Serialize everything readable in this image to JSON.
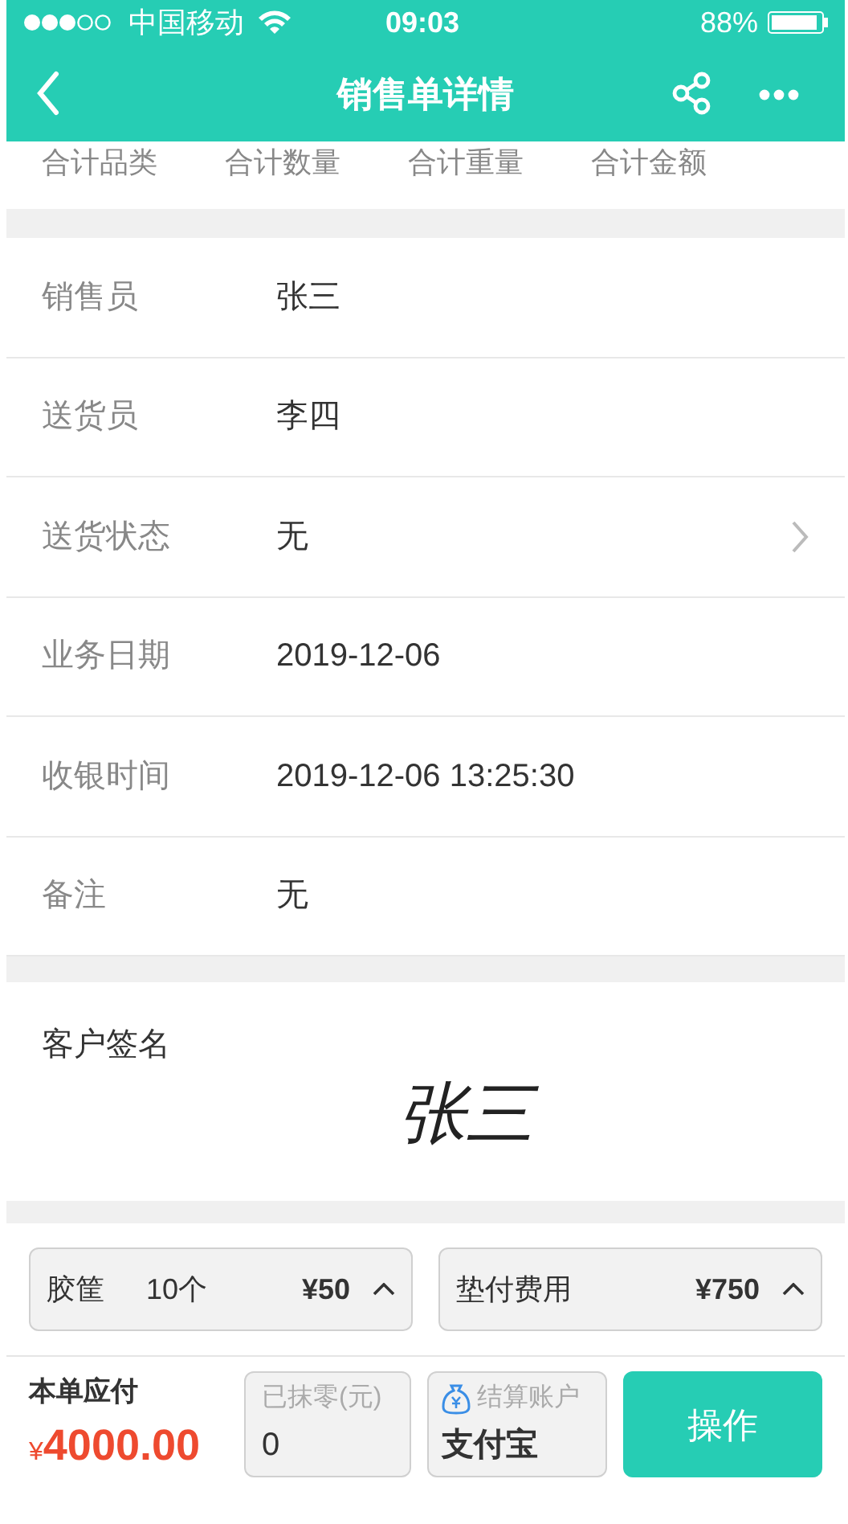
{
  "status_bar": {
    "carrier": "中国移动",
    "time": "09:03",
    "battery": "88%"
  },
  "nav": {
    "title": "销售单详情"
  },
  "summary": [
    "合计品类",
    "合计数量",
    "合计重量",
    "合计金额"
  ],
  "details": [
    {
      "label": "销售员",
      "value": "张三",
      "kind": "plain"
    },
    {
      "label": "送货员",
      "value": "李四",
      "kind": "plain"
    },
    {
      "label": "送货状态",
      "value": "无",
      "kind": "link"
    },
    {
      "label": "业务日期",
      "value": "2019-12-06",
      "kind": "plain"
    },
    {
      "label": "收银时间",
      "value": "2019-12-06 13:25:30",
      "kind": "plain"
    },
    {
      "label": "备注",
      "value": "无",
      "kind": "plain"
    }
  ],
  "signature": {
    "label": "客户签名",
    "name": "张三"
  },
  "chips": [
    {
      "label": "胶筐",
      "count": "10个",
      "amount": "¥50"
    },
    {
      "label": "垫付费用",
      "amount": "¥750"
    }
  ],
  "footer": {
    "total_label": "本单应付",
    "currency": "¥",
    "total": "4000.00",
    "rounding": {
      "label": "已抹零(元)",
      "value": "0"
    },
    "account": {
      "label": "结算账户",
      "value": "支付宝"
    },
    "action": "操作"
  }
}
